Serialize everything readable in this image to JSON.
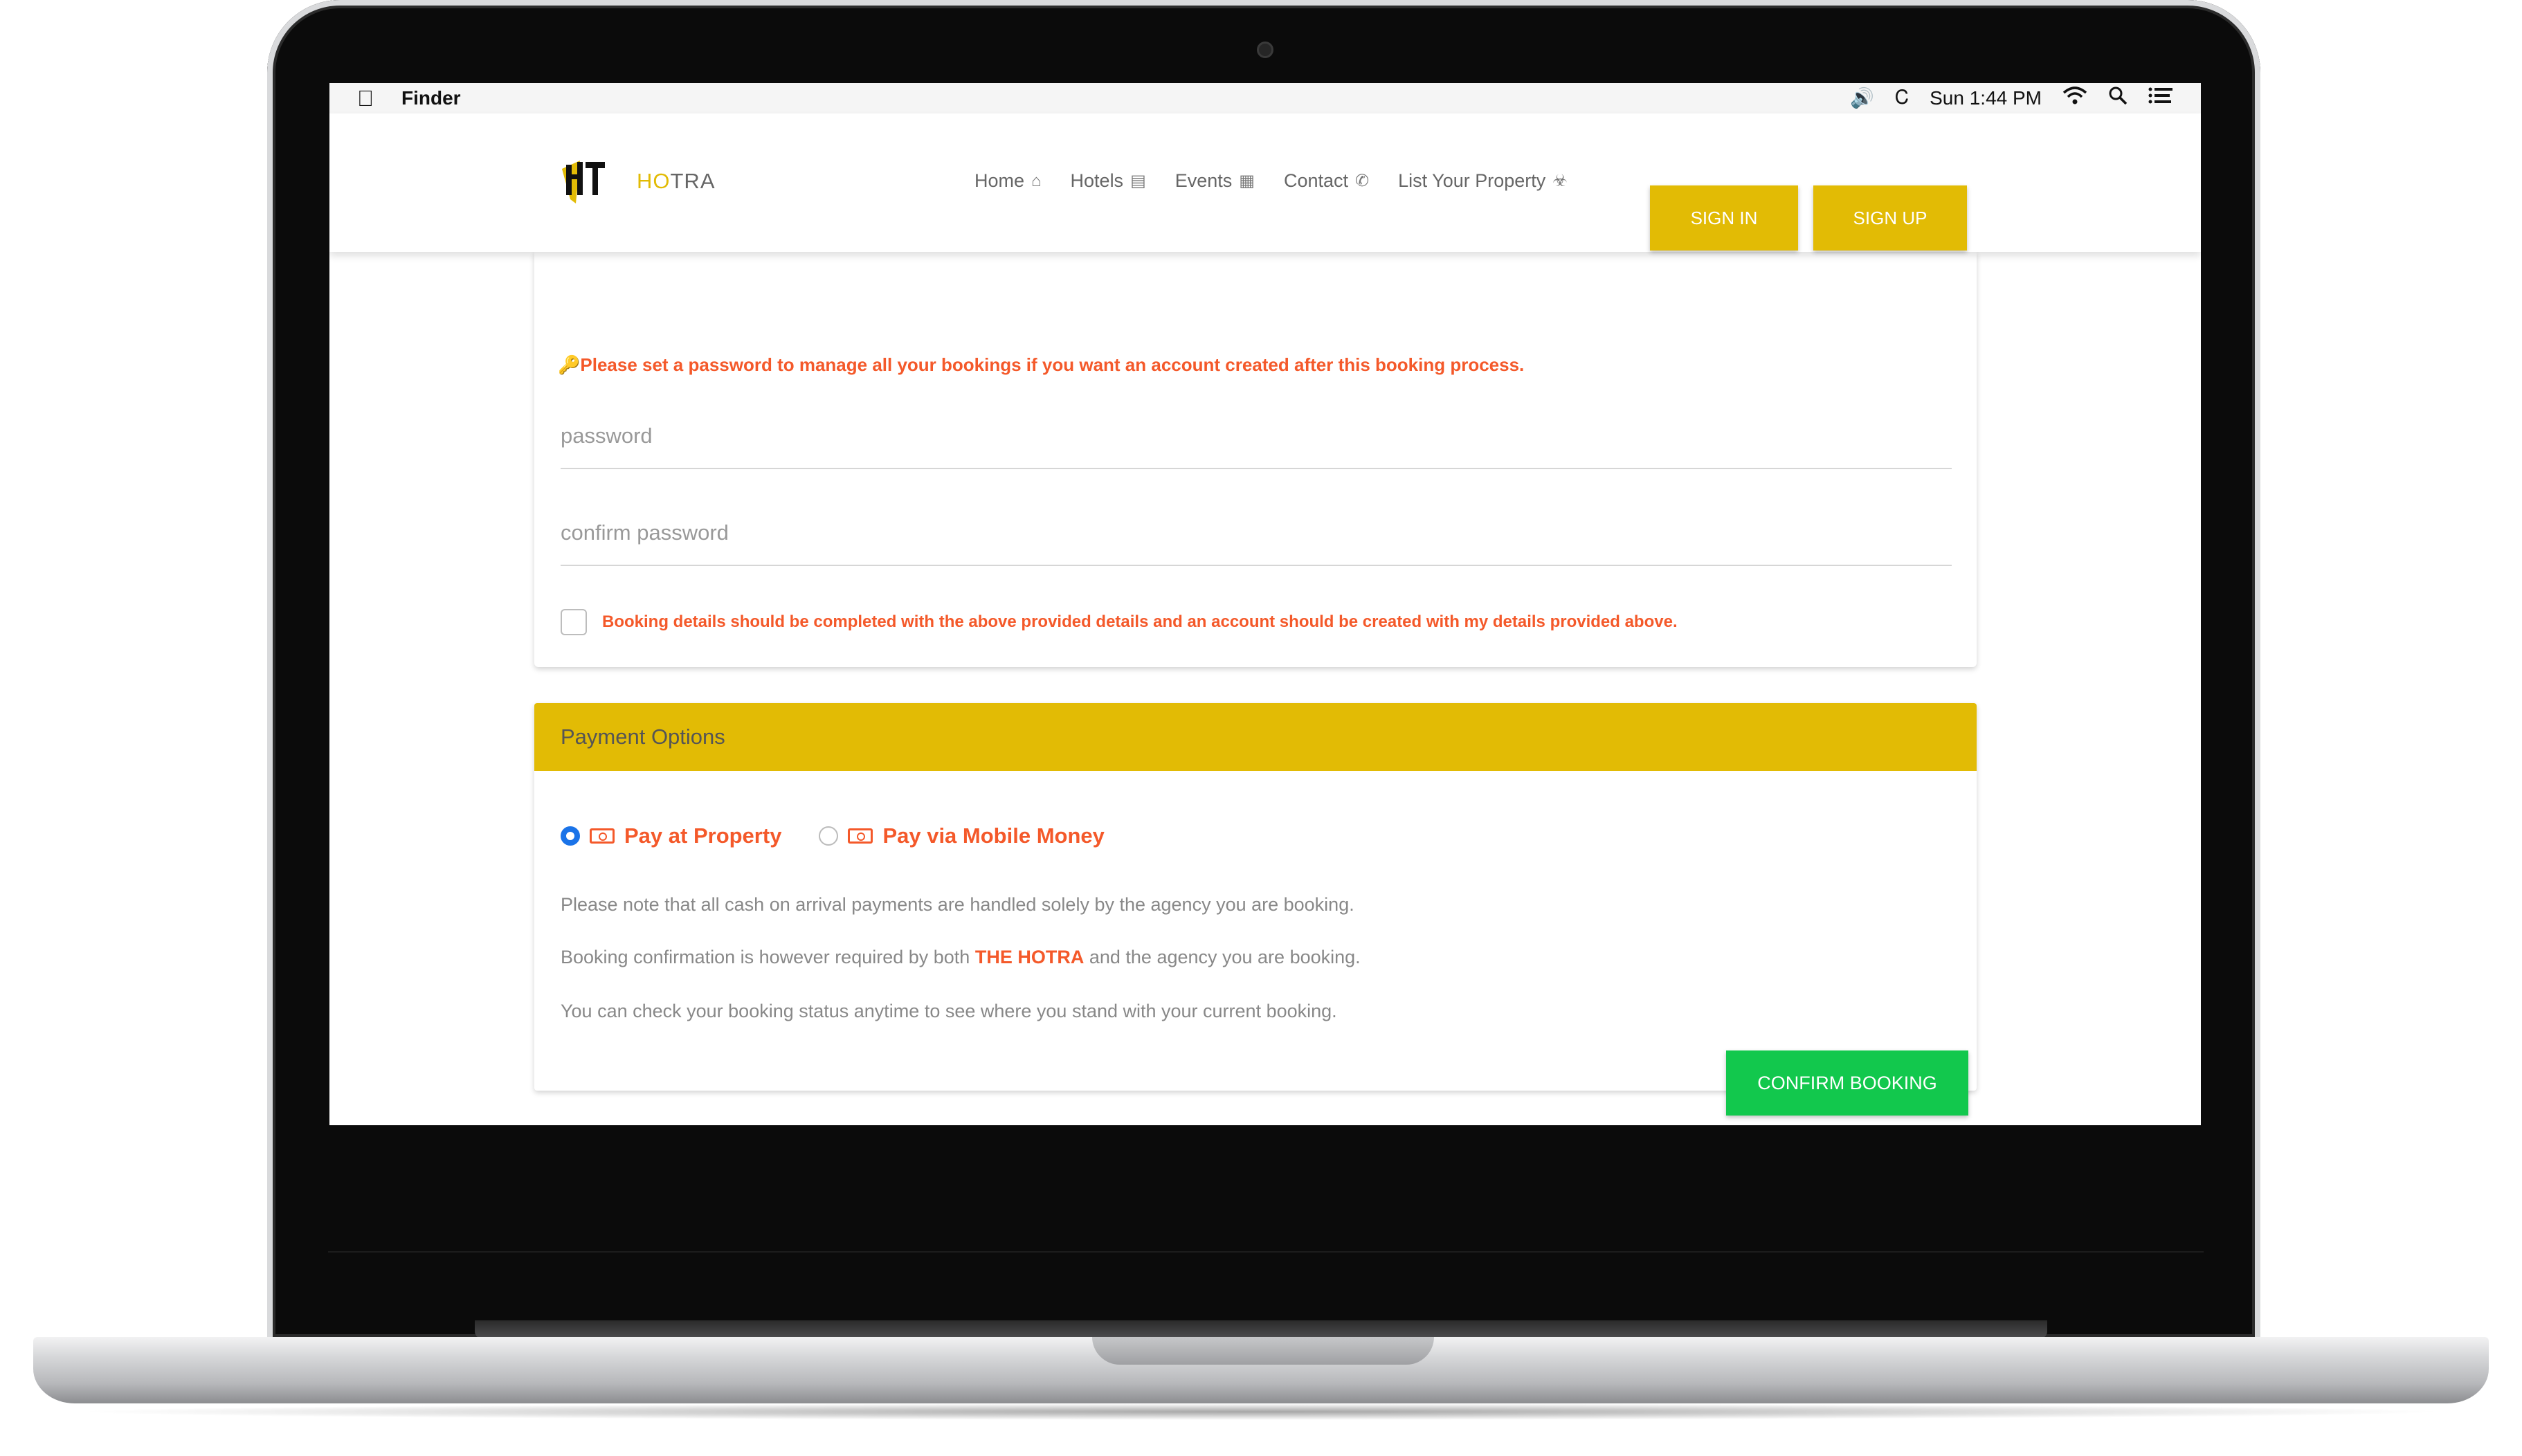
{
  "menubar": {
    "app_name": "Finder",
    "clock": "Sun 1:44 PM",
    "icons": [
      "apple-icon",
      "volume-icon",
      "bluetooth-icon",
      "wifi-icon",
      "search-icon",
      "list-icon"
    ]
  },
  "site": {
    "logo_ho": "HO",
    "logo_tra": "TRA",
    "nav": [
      {
        "label": "Home",
        "icon": "home-icon"
      },
      {
        "label": "Hotels",
        "icon": "bed-icon"
      },
      {
        "label": "Events",
        "icon": "building-icon"
      },
      {
        "label": "Contact",
        "icon": "phone-icon"
      },
      {
        "label": "List Your Property",
        "icon": "handshake-icon"
      }
    ],
    "sign_in": "SIGN IN",
    "sign_up": "SIGN UP"
  },
  "account": {
    "warning": "Please set a password to manage all your bookings if you want an account created after this booking process.",
    "password_placeholder": "password",
    "confirm_placeholder": "confirm password",
    "checkbox_label": "Booking details should be completed with the above provided details and an account should be created with my details provided above."
  },
  "payment": {
    "title": "Payment Options",
    "option1": "Pay at Property",
    "option2": "Pay via Mobile Money",
    "note1": "Please note that all cash on arrival payments are handled solely by the agency you are booking.",
    "note2_pre": "Booking confirmation is however required by both",
    "note2_hl": "THE HOTRA",
    "note2_post": "and the agency you are booking.",
    "note3": "You can check your booking status anytime to see where you stand with your current booking."
  },
  "confirm_label": "CONFIRM BOOKING",
  "colors": {
    "accent": "#e2bb05",
    "warning": "#f4592a",
    "confirm": "#12c84d",
    "radio": "#1a73e8"
  }
}
